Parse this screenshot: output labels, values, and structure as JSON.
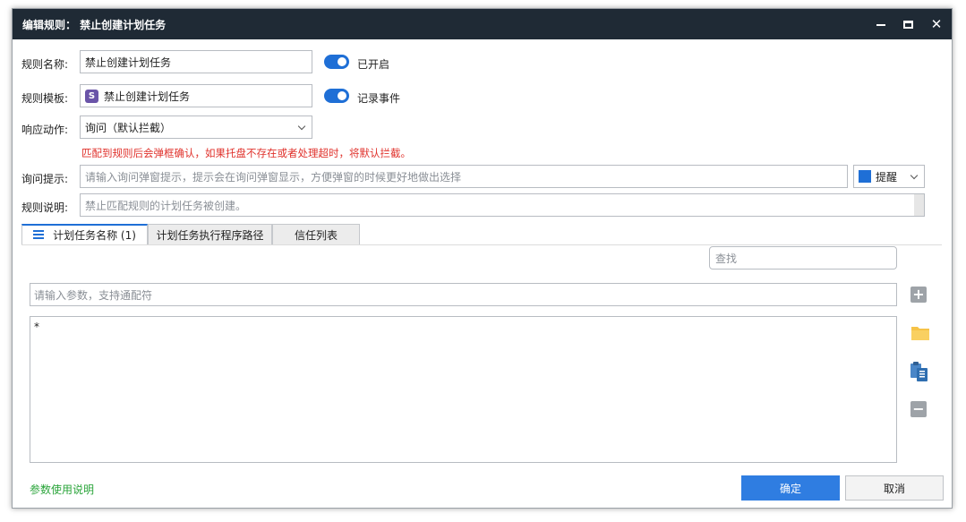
{
  "window": {
    "title": "编辑规则： 禁止创建计划任务"
  },
  "form": {
    "name_label": "规则名称:",
    "name_value": "禁止创建计划任务",
    "enabled_toggle_label": "已开启",
    "template_label": "规则模板:",
    "template_badge": "S",
    "template_value": "禁止创建计划任务",
    "log_toggle_label": "记录事件",
    "action_label": "响应动作:",
    "action_value": "询问（默认拦截）",
    "action_warning": "匹配到规则后会弹框确认，如果托盘不存在或者处理超时，将默认拦截。",
    "prompt_label": "询问提示:",
    "prompt_placeholder": "请输入询问弹窗提示，提示会在询问弹窗显示，方便弹窗的时候更好地做出选择",
    "prompt_level": "提醒",
    "prompt_level_color": "#1f6fd6",
    "desc_label": "规则说明:",
    "desc_value": "禁止匹配规则的计划任务被创建。"
  },
  "tabs": [
    {
      "label": "计划任务名称 (1)",
      "active": true
    },
    {
      "label": "计划任务执行程序路径",
      "active": false
    },
    {
      "label": "信任列表",
      "active": false
    }
  ],
  "list": {
    "search_placeholder": "查找",
    "param_placeholder": "请输入参数，支持通配符",
    "entries": "*"
  },
  "side_tools": [
    "plus-icon",
    "folder-icon",
    "paste-icon",
    "minus-icon"
  ],
  "footer": {
    "help_link": "参数使用说明",
    "ok_label": "确定",
    "cancel_label": "取消"
  },
  "colors": {
    "titlebar": "#1f2a35",
    "accent": "#2f7de1",
    "warning": "#e0322c",
    "link": "#2aa43a"
  }
}
